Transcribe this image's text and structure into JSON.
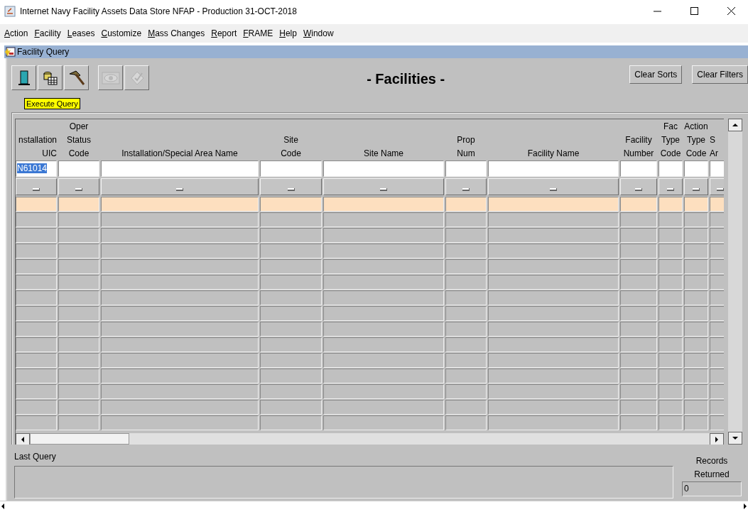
{
  "window": {
    "title": "Internet Navy Facility Assets Data Store NFAP - Production 31-OCT-2018"
  },
  "menu": [
    "Action",
    "Facility",
    "Leases",
    "Customize",
    "Mass Changes",
    "Report",
    "FRAME",
    "Help",
    "Window"
  ],
  "form": {
    "title": "Facility Query"
  },
  "toolbar": [
    {
      "kind": "exit",
      "disabled": false
    },
    {
      "kind": "query",
      "disabled": false
    },
    {
      "kind": "hammer",
      "disabled": false
    },
    {
      "kind": "eye",
      "disabled": true
    },
    {
      "kind": "check",
      "disabled": true
    }
  ],
  "tooltip": "Execute Query",
  "heading": "- Facilities -",
  "buttons": [
    "Clear Sorts",
    "Clear Filters"
  ],
  "columns": [
    {
      "lines": [
        "nstallation",
        "UIC"
      ],
      "filter": {
        "value": "N61014",
        "selected": true
      }
    },
    {
      "lines": [
        "Oper",
        "Status",
        "Code"
      ]
    },
    {
      "lines": [
        "Installation/Special Area Name"
      ]
    },
    {
      "lines": [
        "Site",
        "Code"
      ]
    },
    {
      "lines": [
        "Site Name"
      ]
    },
    {
      "lines": [
        "Prop",
        "Num"
      ]
    },
    {
      "lines": [
        "Facility Name"
      ]
    },
    {
      "lines": [
        "Facility",
        "Number"
      ]
    },
    {
      "lines": [
        "Fac",
        "Type",
        "Code"
      ]
    },
    {
      "lines": [
        "Action",
        "Type",
        "Code"
      ]
    },
    {
      "lines": [
        "S",
        "Ar"
      ]
    }
  ],
  "rows": [
    {
      "selected": true
    },
    {
      "selected": false
    },
    {
      "selected": false
    },
    {
      "selected": false
    },
    {
      "selected": false
    },
    {
      "selected": false
    },
    {
      "selected": false
    },
    {
      "selected": false
    },
    {
      "selected": false
    },
    {
      "selected": false
    },
    {
      "selected": false
    },
    {
      "selected": false
    },
    {
      "selected": false
    },
    {
      "selected": false
    },
    {
      "selected": false
    }
  ],
  "last_query": {
    "label": "Last Query"
  },
  "records": {
    "label": "Records Returned",
    "value": "0"
  }
}
